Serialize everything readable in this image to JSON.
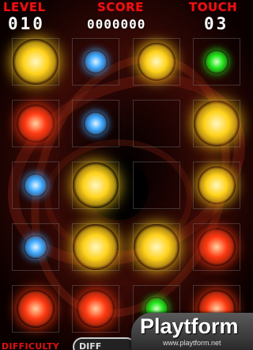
{
  "hud": {
    "level_label": "LEVEL",
    "level_value": "010",
    "score_label": "SCORE",
    "score_value": "0000000",
    "touch_label": "TOUCH",
    "touch_value": "03"
  },
  "grid": {
    "rows": 5,
    "cols": 4,
    "orbs": [
      [
        "yellow-large",
        "blue-small",
        "yellow-medium",
        "green-small"
      ],
      [
        "red-medium",
        "blue-small",
        "empty",
        "yellow-large"
      ],
      [
        "blue-small",
        "yellow-large",
        "empty",
        "yellow-medium"
      ],
      [
        "blue-small",
        "yellow-large",
        "yellow-large",
        "red-medium"
      ],
      [
        "red-medium",
        "red-medium",
        "green-small",
        "red-medium"
      ]
    ]
  },
  "orb_colors": {
    "yellow": "#ffd21a",
    "red": "#ff3a12",
    "blue": "#3fa9ff",
    "green": "#22e81c"
  },
  "bottom": {
    "difficulty_label": "DIFFICULTY",
    "button_label": "DIFF"
  },
  "watermark": {
    "logo": "Playtform",
    "url": "www.playtform.net"
  }
}
